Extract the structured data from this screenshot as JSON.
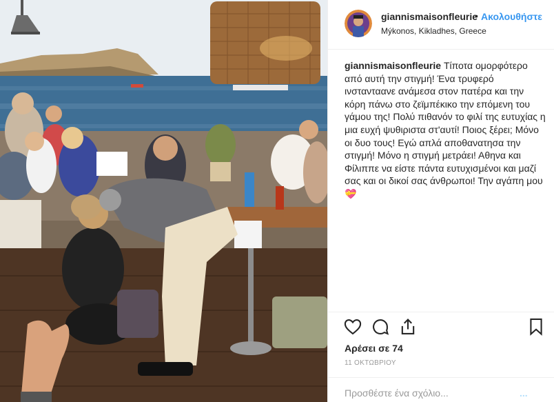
{
  "post": {
    "username": "giannismaisonfleurie",
    "follow_label": "Ακολουθήστε",
    "separator": "•",
    "location": "Mýkonos, Kikladhes, Greece",
    "caption_user": "giannismaisonfleurie",
    "caption_text": "Τίποτα ομορφότερο από αυτή την στιγμή! Ένα τρυφερό ινστανταανε ανάμεσα στον πατέρα και την κόρη πάνω στο ζεϊμπέκικο την επόμενη του γάμου της! Πολύ πιθανόν το φιλί της ευτυχίας η μια ευχή ψυθιριστα στ'αυτί! Ποιος ξέρει; Μόνο οι δυο τους! Εγώ απλά αποθανατησα την στιγμή! Μόνο η στιγμή μετράει! Αθηνα και Φίλιππε να είστε πάντα ευτυχισμένοι και μαζί σας και οι δικοί σας άνθρωποι! Την αγάπη μου 💝",
    "likes": "Αρέσει σε 74",
    "date": "11 ΟΚΤΩΒΡΙΟΥ",
    "comment_placeholder": "Προσθέστε ένα σχόλιο...",
    "post_label": "..."
  },
  "icons": {
    "like": "heart-icon",
    "comment": "comment-icon",
    "share": "share-icon",
    "save": "bookmark-icon",
    "options": "more-icon"
  },
  "colors": {
    "follow_blue": "#3897f0",
    "muted": "#999999",
    "text": "#262626",
    "border": "#efefef"
  }
}
